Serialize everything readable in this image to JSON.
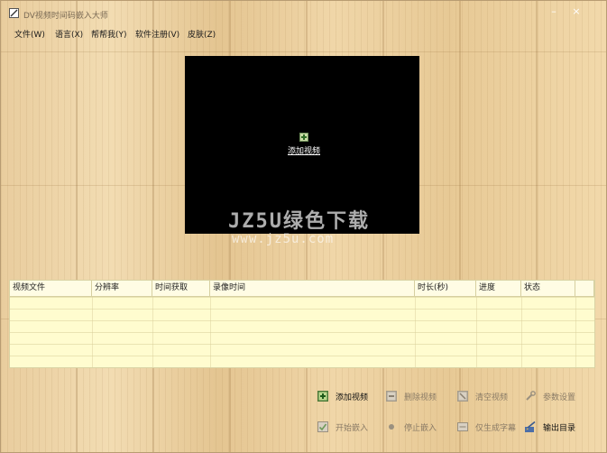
{
  "window": {
    "title": "DV视频时间码嵌入大师",
    "controls": {
      "minimize": "–",
      "close": "×"
    }
  },
  "menu": [
    "文件(W)",
    "语言(X)",
    "帮帮我(Y)",
    "软件注册(V)",
    "皮肤(Z)"
  ],
  "preview": {
    "center_label": "添加视频",
    "watermark_line1": "JZ5U绿色下载",
    "watermark_line2": "www.jz5u.com"
  },
  "table": {
    "columns": [
      "视频文件",
      "分辨率",
      "时间获取",
      "录像时间",
      "时长(秒)",
      "进度",
      "状态",
      ""
    ],
    "rows": []
  },
  "actions": {
    "add_video": "添加视频",
    "delete_video": "删除视频",
    "clear_video": "清空视频",
    "param_settings": "参数设置",
    "start_embed": "开始嵌入",
    "stop_embed": "停止嵌入",
    "subtitle_only": "仅生成字幕",
    "output_dir": "输出目录"
  },
  "colors": {
    "wood_light": "#f2dcb2",
    "wood_mid": "#e7c995",
    "table_bg": "#fffccf",
    "header_bg": "#fffce4",
    "disabled_text": "#8a7b66"
  }
}
